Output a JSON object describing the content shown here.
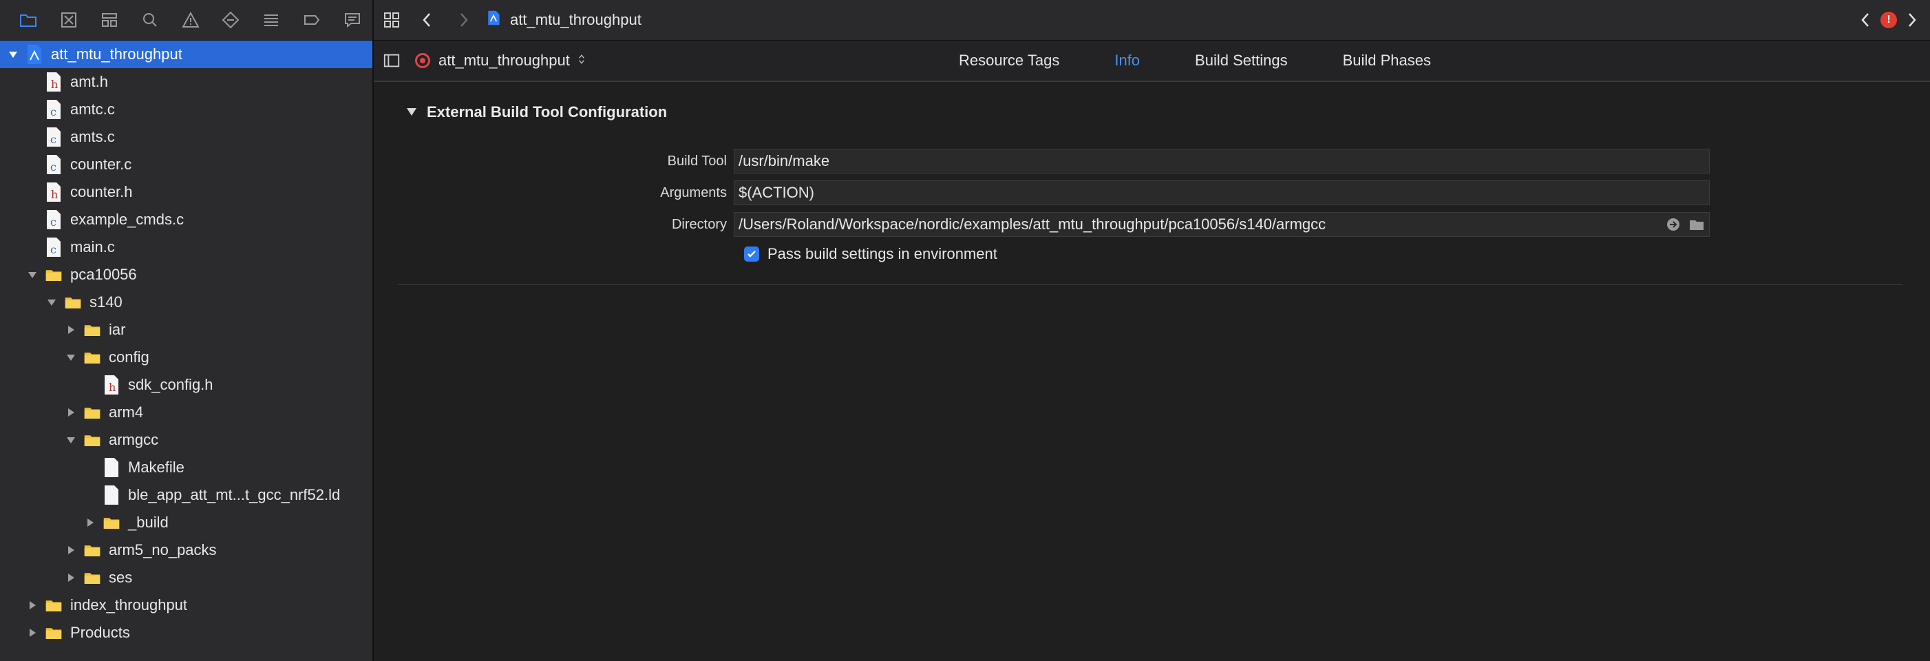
{
  "sidebar": {
    "toolbar_icons": [
      "folder-icon",
      "source-control-icon",
      "hierarchy-icon",
      "search-icon",
      "warning-icon",
      "test-diamond-icon",
      "list-icon",
      "tag-icon",
      "comment-icon"
    ],
    "tree": [
      {
        "label": "att_mtu_throughput",
        "kind": "project",
        "depth": 0,
        "disclosure": "open",
        "selected": true
      },
      {
        "label": "amt.h",
        "kind": "h",
        "depth": 1
      },
      {
        "label": "amtc.c",
        "kind": "c",
        "depth": 1
      },
      {
        "label": "amts.c",
        "kind": "c",
        "depth": 1
      },
      {
        "label": "counter.c",
        "kind": "c",
        "depth": 1
      },
      {
        "label": "counter.h",
        "kind": "h",
        "depth": 1
      },
      {
        "label": "example_cmds.c",
        "kind": "c",
        "depth": 1
      },
      {
        "label": "main.c",
        "kind": "c",
        "depth": 1
      },
      {
        "label": "pca10056",
        "kind": "folder",
        "depth": 1,
        "disclosure": "open"
      },
      {
        "label": "s140",
        "kind": "folder",
        "depth": 2,
        "disclosure": "open"
      },
      {
        "label": "iar",
        "kind": "folder",
        "depth": 3,
        "disclosure": "closed"
      },
      {
        "label": "config",
        "kind": "folder",
        "depth": 3,
        "disclosure": "open"
      },
      {
        "label": "sdk_config.h",
        "kind": "h",
        "depth": 4
      },
      {
        "label": "arm4",
        "kind": "folder",
        "depth": 3,
        "disclosure": "closed"
      },
      {
        "label": "armgcc",
        "kind": "folder",
        "depth": 3,
        "disclosure": "open"
      },
      {
        "label": "Makefile",
        "kind": "file",
        "depth": 4
      },
      {
        "label": "ble_app_att_mt...t_gcc_nrf52.ld",
        "kind": "file",
        "depth": 4
      },
      {
        "label": "_build",
        "kind": "folder",
        "depth": 4,
        "disclosure": "closed"
      },
      {
        "label": "arm5_no_packs",
        "kind": "folder",
        "depth": 3,
        "disclosure": "closed"
      },
      {
        "label": "ses",
        "kind": "folder",
        "depth": 3,
        "disclosure": "closed"
      },
      {
        "label": "index_throughput",
        "kind": "folder",
        "depth": 1,
        "disclosure": "closed"
      },
      {
        "label": "Products",
        "kind": "folder",
        "depth": 1,
        "disclosure": "closed"
      }
    ]
  },
  "topbar": {
    "breadcrumb_title": "att_mtu_throughput",
    "warning_count": "!"
  },
  "tabbar": {
    "target_name": "att_mtu_throughput",
    "tabs": [
      {
        "label": "Resource Tags",
        "active": false
      },
      {
        "label": "Info",
        "active": true
      },
      {
        "label": "Build Settings",
        "active": false
      },
      {
        "label": "Build Phases",
        "active": false
      }
    ]
  },
  "section": {
    "title": "External Build Tool Configuration",
    "fields": [
      {
        "label": "Build Tool",
        "value": "/usr/bin/make"
      },
      {
        "label": "Arguments",
        "value": "$(ACTION)"
      },
      {
        "label": "Directory",
        "value": "/Users/Roland/Workspace/nordic/examples/att_mtu_throughput/pca10056/s140/armgcc"
      }
    ],
    "checkbox_label": "Pass build settings in environment",
    "checkbox_checked": true
  },
  "colors": {
    "accent": "#2a6ad8",
    "active_tab": "#4a90f0",
    "folder": "#f2c230",
    "header_icon": "#d8474a"
  }
}
